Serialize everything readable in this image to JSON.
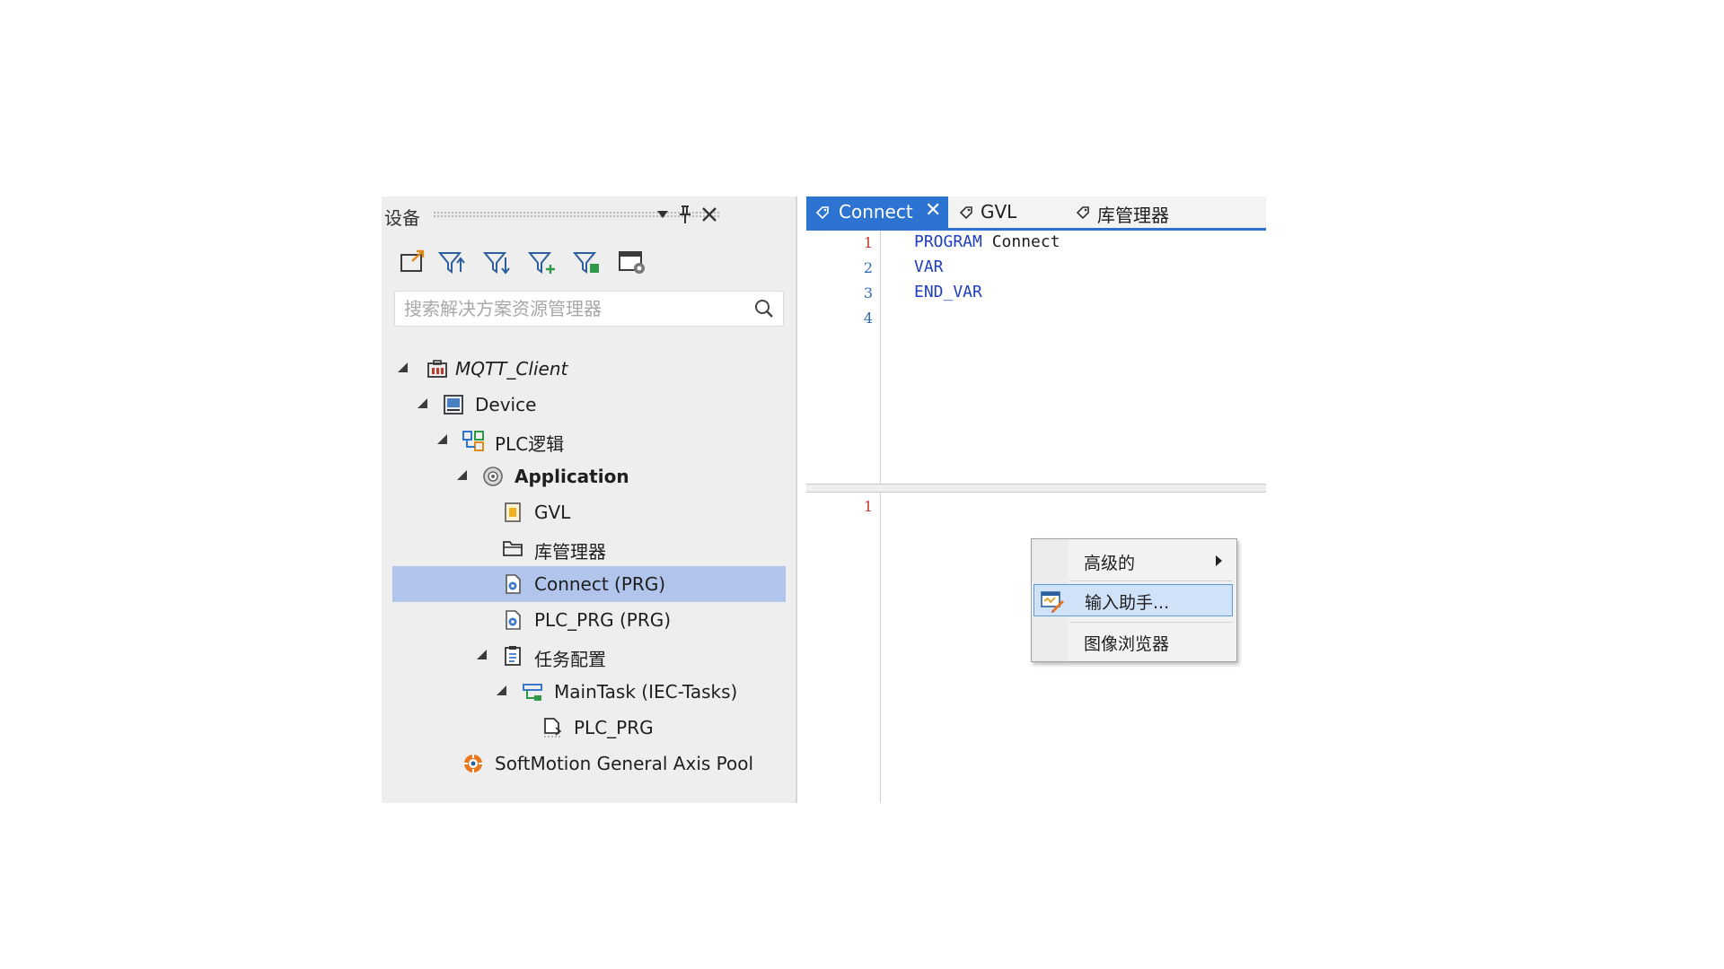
{
  "devices_panel": {
    "title": "设备",
    "header_buttons": [
      "dropdown-icon",
      "pin-icon",
      "close-icon"
    ],
    "toolbar_icons": [
      "open-folder-icon",
      "filter-up-icon",
      "filter-down-icon",
      "filter-plus-icon",
      "filter-green-icon",
      "window-settings-icon"
    ],
    "search_placeholder": "搜索解决方案资源管理器",
    "tree": [
      {
        "label": "MQTT_Client",
        "icon": "project-icon",
        "expanded": true
      },
      {
        "label": "Device",
        "icon": "device-icon",
        "expanded": true
      },
      {
        "label": "PLC逻辑",
        "icon": "plc-logic-icon",
        "expanded": true
      },
      {
        "label": "Application",
        "icon": "application-icon",
        "expanded": true
      },
      {
        "label": "GVL",
        "icon": "gvl-icon"
      },
      {
        "label": "库管理器",
        "icon": "library-folder-icon"
      },
      {
        "label": "Connect (PRG)",
        "icon": "program-icon",
        "selected": true
      },
      {
        "label": "PLC_PRG (PRG)",
        "icon": "program-icon"
      },
      {
        "label": "任务配置",
        "icon": "task-config-icon",
        "expanded": true
      },
      {
        "label": "MainTask (IEC-Tasks)",
        "icon": "task-icon",
        "expanded": true
      },
      {
        "label": "PLC_PRG",
        "icon": "program-call-icon"
      },
      {
        "label": "SoftMotion General Axis Pool",
        "icon": "softmotion-icon"
      }
    ]
  },
  "editor": {
    "tabs": [
      {
        "label": "Connect",
        "active": true,
        "closable": true
      },
      {
        "label": "GVL",
        "active": false
      },
      {
        "label": "库管理器",
        "active": false
      }
    ],
    "declaration_lines": [
      {
        "num": "1",
        "keyword": "PROGRAM",
        "rest": " Connect"
      },
      {
        "num": "2",
        "keyword": "VAR",
        "rest": ""
      },
      {
        "num": "3",
        "keyword": "END_VAR",
        "rest": ""
      },
      {
        "num": "4",
        "keyword": "",
        "rest": ""
      }
    ],
    "body_lines": [
      {
        "num": "1"
      }
    ]
  },
  "context_menu": {
    "items": [
      {
        "label": "高级的",
        "has_submenu": true
      },
      {
        "label": "输入助手...",
        "highlighted": true,
        "icon": "input-assistant-icon"
      },
      {
        "label": "图像浏览器"
      }
    ]
  },
  "colors": {
    "accent": "#2d74d2",
    "selection": "#b0c4ec",
    "keyword": "#1f3fbf",
    "menu_highlight": "#cfe2f7"
  }
}
